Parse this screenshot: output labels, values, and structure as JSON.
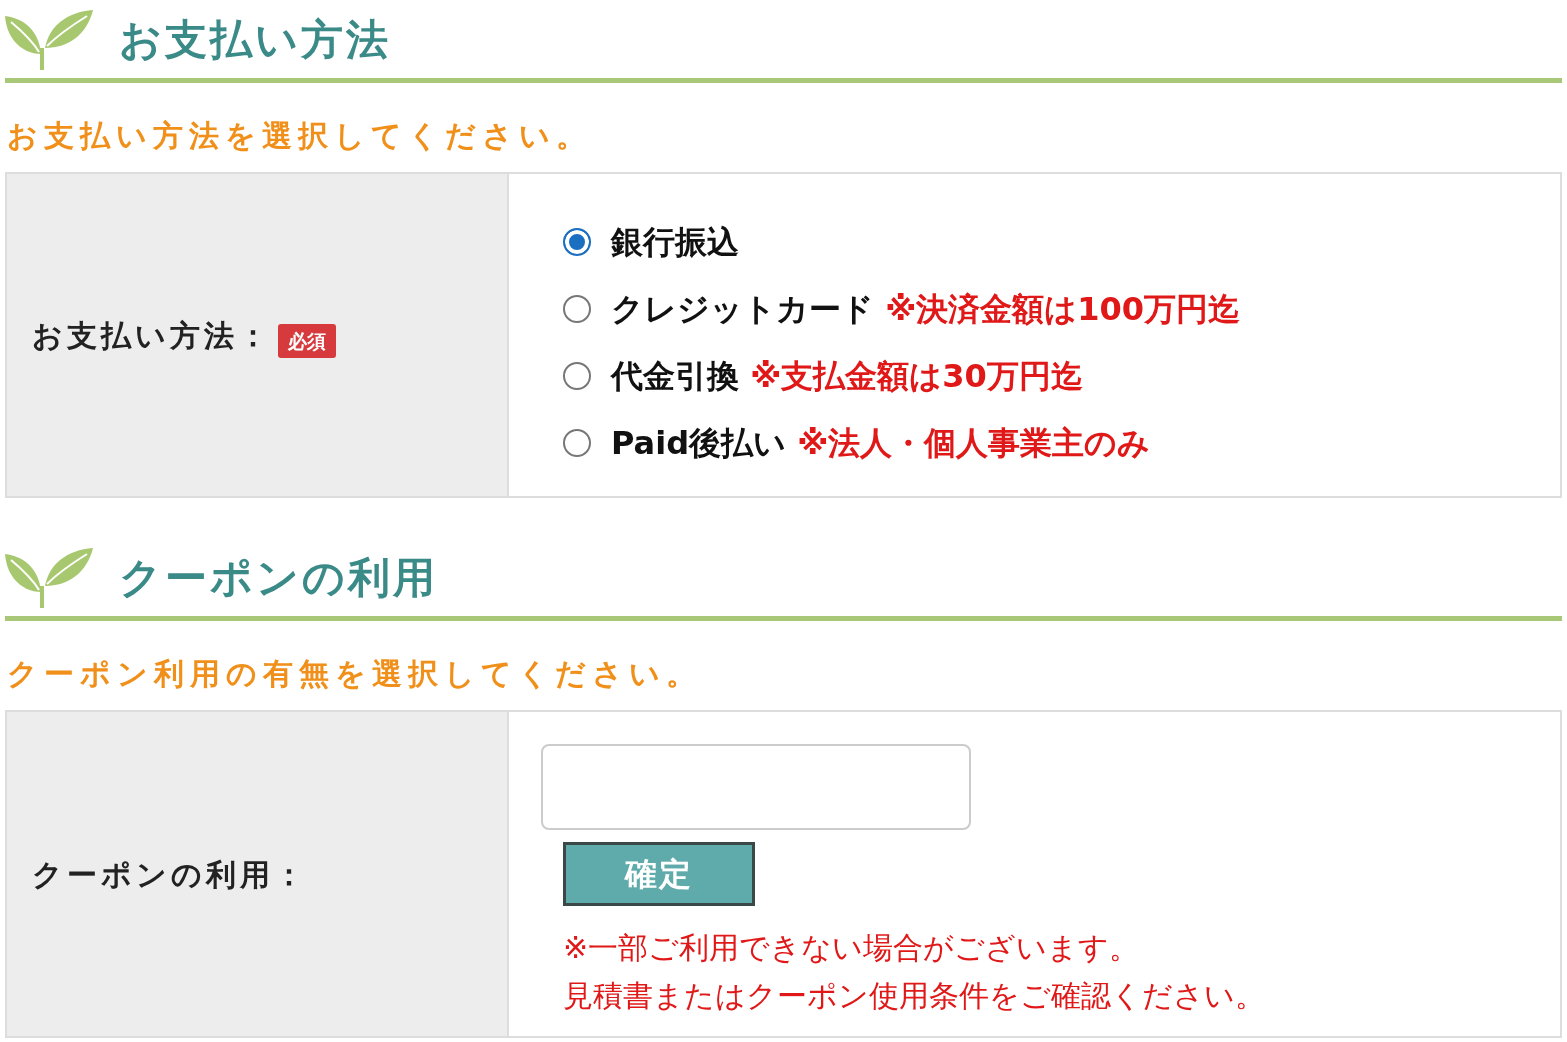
{
  "sections": [
    {
      "kind": "payment",
      "title": "お支払い方法",
      "instruction": "お支払い方法を選択してください。",
      "label": "お支払い方法：",
      "required_badge": "必須",
      "options": [
        {
          "label": "銀行振込",
          "selected": true
        },
        {
          "label": "クレジットカード",
          "note": "※決済金額は100万円迄",
          "selected": false
        },
        {
          "label": "代金引換",
          "note": "※支払金額は30万円迄",
          "selected": false
        },
        {
          "label": "Paid後払い",
          "note": "※法人・個人事業主のみ",
          "selected": false
        }
      ]
    },
    {
      "kind": "coupon",
      "title": "クーポンの利用",
      "instruction": "クーポン利用の有無を選択してください。",
      "label": "クーポンの利用：",
      "button": "確定",
      "notes": [
        "※一部ご利用できない場合がございます。",
        "見積書またはクーポン使用条件をご確認ください。"
      ]
    }
  ]
}
